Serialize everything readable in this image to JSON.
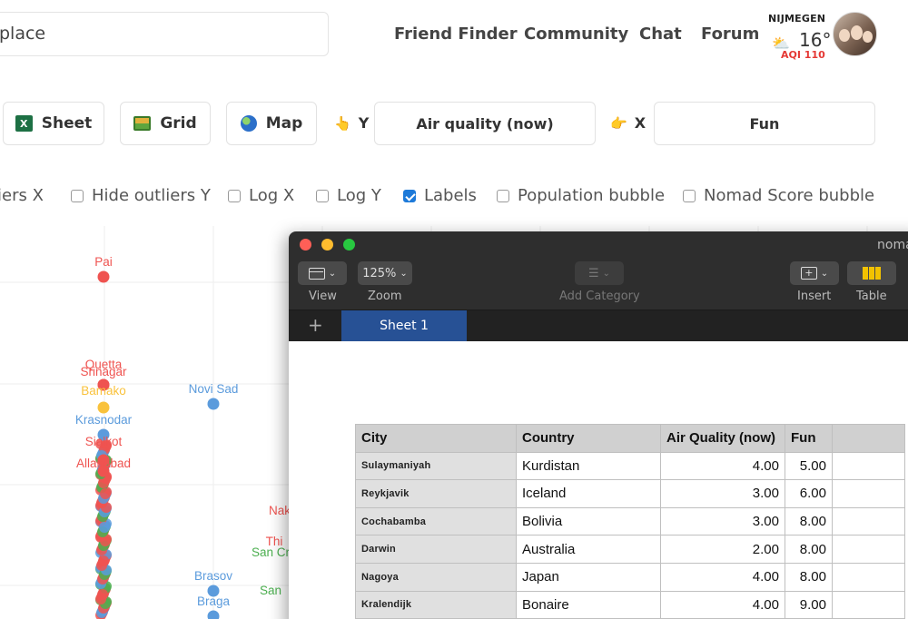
{
  "header": {
    "search_value": "place",
    "nav": [
      "Friend Finder",
      "Community",
      "Chat",
      "Forum"
    ],
    "weather": {
      "city": "NIJMEGEN",
      "temp": "16°",
      "aqi": "AQI 110",
      "icon": "partly-cloudy-icon"
    }
  },
  "controls": {
    "sheet_label": "Sheet",
    "grid_label": "Grid",
    "map_label": "Map",
    "y_label": "Y",
    "y_value": "Air quality (now)",
    "x_label": "X",
    "x_value": "Fun"
  },
  "checks": [
    {
      "label": "liers X",
      "checked": false
    },
    {
      "label": "Hide outliers Y",
      "checked": false
    },
    {
      "label": "Log X",
      "checked": false
    },
    {
      "label": "Log Y",
      "checked": false
    },
    {
      "label": "Labels",
      "checked": true
    },
    {
      "label": "Population bubble",
      "checked": false
    },
    {
      "label": "Nomad Score bubble",
      "checked": false
    }
  ],
  "chart_points": [
    {
      "label": "Pai",
      "color": "#ef5350"
    },
    {
      "label": "Quetta",
      "color": "#ef5350"
    },
    {
      "label": "Srinagar",
      "color": "#ef5350"
    },
    {
      "label": "Bamako",
      "color": "#f9c23c"
    },
    {
      "label": "Novi Sad",
      "color": "#5b9bdc"
    },
    {
      "label": "Krasnodar",
      "color": "#5b9bdc"
    },
    {
      "label": "Sialkot",
      "color": "#ef5350"
    },
    {
      "label": "Allahabad",
      "color": "#ef5350"
    },
    {
      "label": "Brasov",
      "color": "#5b9bdc"
    },
    {
      "label": "Braga",
      "color": "#5b9bdc"
    },
    {
      "label": "San Cr",
      "color": "#4caf50"
    },
    {
      "label": "San",
      "color": "#4caf50"
    },
    {
      "label": "Nak",
      "color": "#ef5350"
    },
    {
      "label": "Thi",
      "color": "#ef5350"
    }
  ],
  "numbers_window": {
    "title": "noma",
    "toolbar": {
      "view": "View",
      "zoom": "Zoom",
      "zoom_value": "125%",
      "add_category": "Add Category",
      "insert": "Insert",
      "table": "Table"
    },
    "tab": "Sheet 1",
    "table": {
      "headers": [
        "City",
        "Country",
        "Air Quality (now)",
        "Fun"
      ],
      "rows": [
        [
          "Sulaymaniyah",
          "Kurdistan",
          "4.00",
          "5.00"
        ],
        [
          "Reykjavik",
          "Iceland",
          "3.00",
          "6.00"
        ],
        [
          "Cochabamba",
          "Bolivia",
          "3.00",
          "8.00"
        ],
        [
          "Darwin",
          "Australia",
          "2.00",
          "8.00"
        ],
        [
          "Nagoya",
          "Japan",
          "4.00",
          "8.00"
        ],
        [
          "Kralendijk",
          "Bonaire",
          "4.00",
          "9.00"
        ]
      ]
    }
  }
}
